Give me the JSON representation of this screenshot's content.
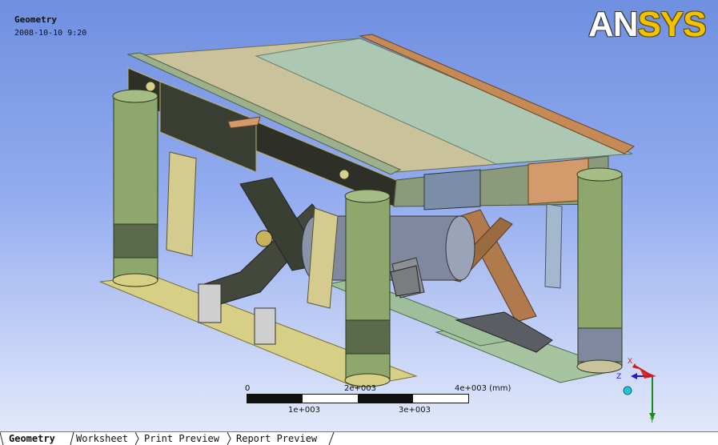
{
  "viewport": {
    "title": "Geometry",
    "date": "2008-10-10 9:20",
    "logo_white": "AN",
    "logo_yellow": "SYS"
  },
  "scale_bar": {
    "label_0": "0",
    "label_2e3": "2e+003",
    "label_4e3_unit": "4e+003 (mm)",
    "label_1e3": "1e+003",
    "label_3e3": "3e+003"
  },
  "triad": {
    "x": "X",
    "y": "Y",
    "z": "Z",
    "x_color": "#d11a1a",
    "y_color": "#1a8a1a",
    "z_color": "#1a1ad1",
    "iso_ball_color": "#22c4d6"
  },
  "tabs": [
    {
      "label": "Geometry",
      "active": true
    },
    {
      "label": "Worksheet",
      "active": false
    },
    {
      "label": "Print Preview",
      "active": false
    },
    {
      "label": "Report Preview",
      "active": false
    }
  ],
  "icons": {
    "model": "vibration-table-assembly-3d-model",
    "triad": "axis-triad-icon",
    "iso_ball": "isometric-view-ball-icon"
  }
}
